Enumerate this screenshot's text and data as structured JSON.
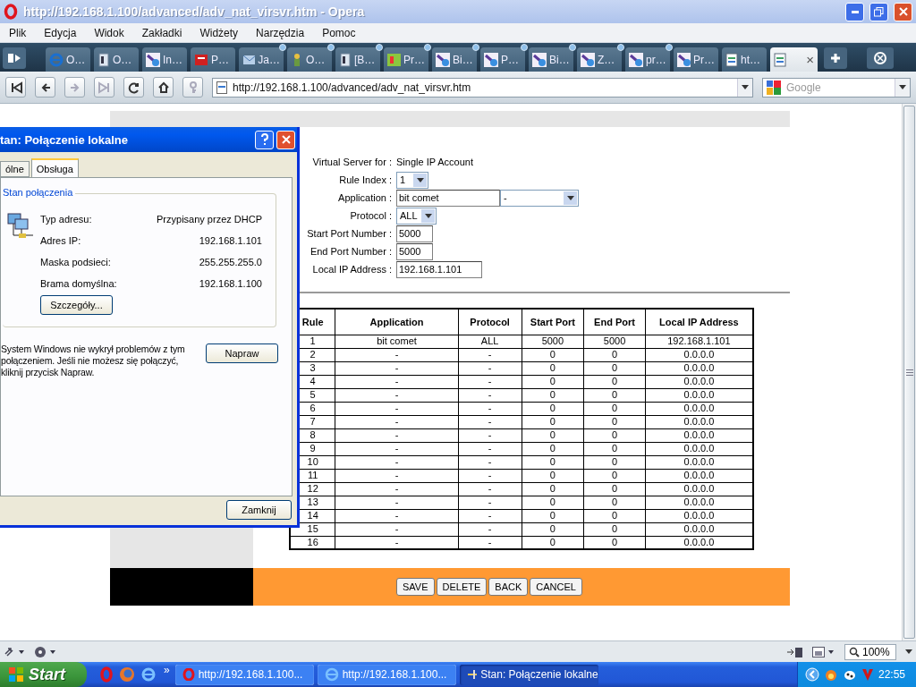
{
  "window": {
    "title": "http://192.168.1.100/advanced/adv_nat_virsvr.htm - Opera"
  },
  "menu": [
    "Plik",
    "Edycja",
    "Widok",
    "Zakładki",
    "Widżety",
    "Narzędzia",
    "Pomoc"
  ],
  "tabs": [
    {
      "label": "O…",
      "kind": "globe",
      "unread": false,
      "selected": false
    },
    {
      "label": "O…",
      "kind": "document",
      "unread": false,
      "selected": false
    },
    {
      "label": "In…",
      "kind": "magnifier",
      "unread": false,
      "selected": false
    },
    {
      "label": "P…",
      "kind": "logo",
      "unread": false,
      "selected": false
    },
    {
      "label": "Ja…",
      "kind": "envelope",
      "unread": true,
      "selected": false
    },
    {
      "label": "O…",
      "kind": "figure",
      "unread": true,
      "selected": false
    },
    {
      "label": "[B…",
      "kind": "document",
      "unread": true,
      "selected": false
    },
    {
      "label": "Pr…",
      "kind": "badge",
      "unread": true,
      "selected": false
    },
    {
      "label": "Bi…",
      "kind": "magnifier",
      "unread": true,
      "selected": false
    },
    {
      "label": "P…",
      "kind": "magnifier",
      "unread": true,
      "selected": false
    },
    {
      "label": "Bi…",
      "kind": "magnifier",
      "unread": true,
      "selected": false
    },
    {
      "label": "Z…",
      "kind": "magnifier",
      "unread": true,
      "selected": false
    },
    {
      "label": "pr…",
      "kind": "magnifier",
      "unread": true,
      "selected": false
    },
    {
      "label": "Pr…",
      "kind": "magnifier",
      "unread": false,
      "selected": false
    },
    {
      "label": "ht…",
      "kind": "page",
      "unread": false,
      "selected": false
    },
    {
      "kind": "page",
      "close": "×",
      "unread": false,
      "selected": true
    }
  ],
  "address_bar": {
    "url": "http://192.168.1.100/advanced/adv_nat_virsvr.htm"
  },
  "search": {
    "placeholder": "Google"
  },
  "page": {
    "form": [
      {
        "label": "Virtual Server for :",
        "kind": "text",
        "value": "Single IP Account"
      },
      {
        "label": "Rule Index :",
        "kind": "select",
        "value": "1"
      },
      {
        "label": "Application :",
        "kind": "input_select",
        "value": "bit comet",
        "option": "-"
      },
      {
        "label": "Protocol :",
        "kind": "select",
        "value": "ALL"
      },
      {
        "label": "Start Port Number :",
        "kind": "input",
        "value": "5000"
      },
      {
        "label": "End Port Number :",
        "kind": "input",
        "value": "5000"
      },
      {
        "label": "Local IP Address :",
        "kind": "wide_input",
        "value": "192.168.1.101"
      }
    ],
    "table": {
      "columns": [
        "Rule",
        "Application",
        "Protocol",
        "Start Port",
        "End Port",
        "Local IP Address"
      ],
      "rows": [
        [
          "1",
          "bit comet",
          "ALL",
          "5000",
          "5000",
          "192.168.1.101"
        ],
        [
          "2",
          "-",
          "-",
          "0",
          "0",
          "0.0.0.0"
        ],
        [
          "3",
          "-",
          "-",
          "0",
          "0",
          "0.0.0.0"
        ],
        [
          "4",
          "-",
          "-",
          "0",
          "0",
          "0.0.0.0"
        ],
        [
          "5",
          "-",
          "-",
          "0",
          "0",
          "0.0.0.0"
        ],
        [
          "6",
          "-",
          "-",
          "0",
          "0",
          "0.0.0.0"
        ],
        [
          "7",
          "-",
          "-",
          "0",
          "0",
          "0.0.0.0"
        ],
        [
          "8",
          "-",
          "-",
          "0",
          "0",
          "0.0.0.0"
        ],
        [
          "9",
          "-",
          "-",
          "0",
          "0",
          "0.0.0.0"
        ],
        [
          "10",
          "-",
          "-",
          "0",
          "0",
          "0.0.0.0"
        ],
        [
          "11",
          "-",
          "-",
          "0",
          "0",
          "0.0.0.0"
        ],
        [
          "12",
          "-",
          "-",
          "0",
          "0",
          "0.0.0.0"
        ],
        [
          "13",
          "-",
          "-",
          "0",
          "0",
          "0.0.0.0"
        ],
        [
          "14",
          "-",
          "-",
          "0",
          "0",
          "0.0.0.0"
        ],
        [
          "15",
          "-",
          "-",
          "0",
          "0",
          "0.0.0.0"
        ],
        [
          "16",
          "-",
          "-",
          "0",
          "0",
          "0.0.0.0"
        ]
      ]
    },
    "buttons": [
      "SAVE",
      "DELETE",
      "BACK",
      "CANCEL"
    ]
  },
  "dialog": {
    "title": "tan: Połączenie lokalne",
    "tabs": [
      {
        "label": "ólne",
        "selected": false
      },
      {
        "label": "Obsługa",
        "selected": true
      }
    ],
    "group": {
      "title": "Stan połączenia",
      "rows": [
        {
          "label": "Typ adresu:",
          "value": "Przypisany przez DHCP"
        },
        {
          "label": "Adres IP:",
          "value": "192.168.1.101"
        },
        {
          "label": "Maska podsieci:",
          "value": "255.255.255.0"
        },
        {
          "label": "Brama domyślna:",
          "value": "192.168.1.100"
        }
      ]
    },
    "details_button": "Szczegóły...",
    "message": "System Windows nie wykrył problemów z tym połączeniem. Jeśli nie możesz się połączyć, kliknij przycisk Napraw.",
    "repair_button": "Napraw",
    "close_button": "Zamknij"
  },
  "status_bar": {
    "zoom": "100%"
  },
  "taskbar": {
    "start": "Start",
    "chevron": "»",
    "tasks": [
      {
        "label": "http://192.168.1.100...",
        "kind": "opera",
        "selected": false
      },
      {
        "label": "http://192.168.1.100...",
        "kind": "globe",
        "selected": false
      },
      {
        "label": "Stan: Połączenie lokalne",
        "kind": "network",
        "selected": true
      }
    ],
    "clock": "22:55"
  }
}
